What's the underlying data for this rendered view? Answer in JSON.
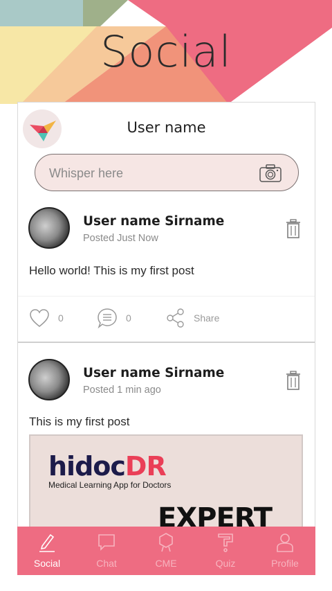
{
  "hero": {
    "title": "Social"
  },
  "top_bar": {
    "username": "User name"
  },
  "whisper": {
    "placeholder": "Whisper here"
  },
  "posts": [
    {
      "author": "User name Sirname",
      "posted": "Posted Just Now",
      "text": "Hello world! This is my first post",
      "likes": "0",
      "comments": "0",
      "share_label": "Share"
    },
    {
      "author": "User name Sirname",
      "posted": "Posted 1 min ago",
      "text": "This is my first post",
      "image": {
        "brand_main": "hidoc",
        "brand_suffix": "DR",
        "tagline": "Medical Learning App for Doctors",
        "headline": "EXPERT"
      }
    }
  ],
  "tabs": [
    {
      "label": "Social",
      "icon": "pencil-icon",
      "active": true
    },
    {
      "label": "Chat",
      "icon": "chat-icon",
      "active": false
    },
    {
      "label": "CME",
      "icon": "badge-icon",
      "active": false
    },
    {
      "label": "Quiz",
      "icon": "question-icon",
      "active": false
    },
    {
      "label": "Profile",
      "icon": "person-icon",
      "active": false
    }
  ],
  "colors": {
    "accent": "#ee6c82",
    "tab_active_text": "#ffffff",
    "tab_inactive_text": "#f7b4bf"
  }
}
